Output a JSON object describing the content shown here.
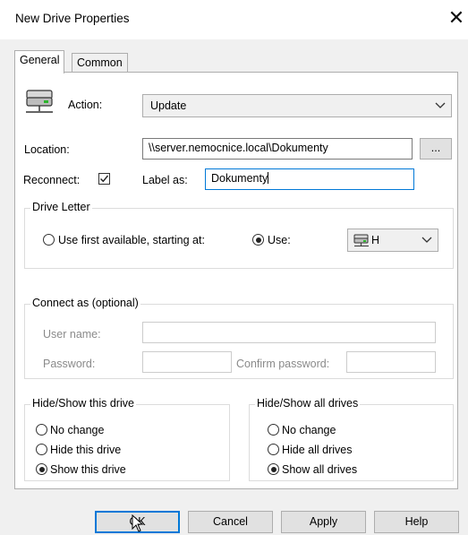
{
  "window": {
    "title": "New Drive Properties",
    "close_glyph": "✕"
  },
  "tabs": [
    {
      "label": "General",
      "active": true
    },
    {
      "label": "Common",
      "active": false
    }
  ],
  "action": {
    "label": "Action:",
    "value": "Update",
    "icon": "network-drive-icon"
  },
  "location": {
    "label": "Location:",
    "value": "\\\\server.nemocnice.local\\Dokumenty",
    "browse_label": "..."
  },
  "reconnect": {
    "label": "Reconnect:",
    "checked": true
  },
  "label_as": {
    "label": "Label as:",
    "value": "Dokumenty"
  },
  "drive_letter": {
    "legend": "Drive Letter",
    "use_first_label": "Use first available, starting at:",
    "use_label": "Use:",
    "selected": "use",
    "letter": "H"
  },
  "connect_as": {
    "legend": "Connect as (optional)",
    "user_label": "User name:",
    "password_label": "Password:",
    "confirm_label": "Confirm password:"
  },
  "hide_show_drive": {
    "legend": "Hide/Show this drive",
    "options": [
      "No change",
      "Hide this drive",
      "Show this drive"
    ],
    "selected": 2
  },
  "hide_show_all": {
    "legend": "Hide/Show all drives",
    "options": [
      "No change",
      "Hide all drives",
      "Show all drives"
    ],
    "selected": 2
  },
  "buttons": {
    "ok": "OK",
    "cancel": "Cancel",
    "apply": "Apply",
    "help": "Help"
  },
  "colors": {
    "focus_blue": "#0078d7",
    "panel_bg": "#ffffff",
    "dialog_bg": "#f0f0f0"
  }
}
